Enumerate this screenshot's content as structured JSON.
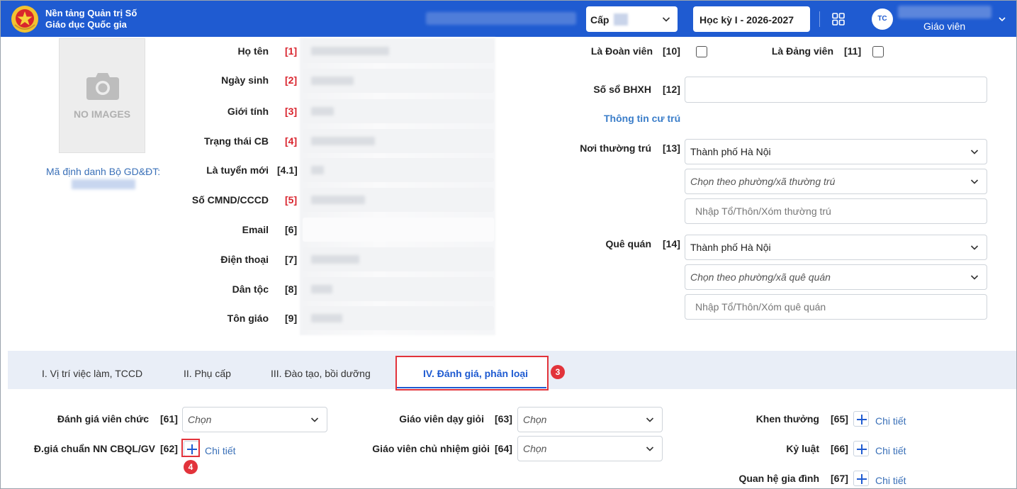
{
  "header": {
    "brand_line1": "Nền tảng Quản trị Số",
    "brand_line2": "Giáo dục Quốc gia",
    "cap_label": "Cấp",
    "term": "Học kỳ I - 2026-2027",
    "avatar_initials": "TC",
    "role": "Giáo viên"
  },
  "photo": {
    "no_images": "NO IMAGES",
    "ma_dinh_danh_label": "Mã định danh Bộ GD&ĐT:"
  },
  "left_fields": [
    {
      "label": "Họ tên",
      "num": "[1]"
    },
    {
      "label": "Ngày sinh",
      "num": "[2]"
    },
    {
      "label": "Giới tính",
      "num": "[3]"
    },
    {
      "label": "Trạng thái CB",
      "num": "[4]"
    },
    {
      "label": "Là tuyển mới",
      "num": "[4.1]"
    },
    {
      "label": "Số CMND/CCCD",
      "num": "[5]"
    },
    {
      "label": "Email",
      "num": "[6]"
    },
    {
      "label": "Điện thoại",
      "num": "[7]"
    },
    {
      "label": "Dân tộc",
      "num": "[8]"
    },
    {
      "label": "Tôn giáo",
      "num": "[9]"
    }
  ],
  "right_fields": {
    "doan_vien": {
      "label": "Là Đoàn viên",
      "num": "[10]"
    },
    "dang_vien": {
      "label": "Là Đảng viên",
      "num": "[11]"
    },
    "bhxh": {
      "label": "Số sổ BHXH",
      "num": "[12]"
    },
    "cu_tru_title": "Thông tin cư trú",
    "thuong_tru": {
      "label": "Nơi thường trú",
      "num": "[13]",
      "province": "Thành phố Hà Nội",
      "ward_placeholder": "Chọn theo phường/xã thường trú",
      "hamlet_placeholder": "Nhập Tổ/Thôn/Xóm thường trú"
    },
    "que_quan": {
      "label": "Quê quán",
      "num": "[14]",
      "province": "Thành phố Hà Nội",
      "ward_placeholder": "Chọn theo phường/xã quê quán",
      "hamlet_placeholder": "Nhập Tổ/Thôn/Xóm quê quán"
    }
  },
  "tabs": [
    {
      "label": "I. Vị trí việc làm, TCCD"
    },
    {
      "label": "II. Phụ cấp"
    },
    {
      "label": "III. Đào tạo, bồi dưỡng"
    },
    {
      "label": "IV. Đánh giá, phân loại"
    }
  ],
  "annotations": {
    "tab_step": "3",
    "plus_step": "4"
  },
  "evaluation": {
    "danh_gia_vc": {
      "label": "Đánh giá viên chức",
      "num": "[61]",
      "value": "Chọn"
    },
    "chuan_nn": {
      "label": "Đ.giá chuẩn NN CBQL/GV",
      "num": "[62]",
      "detail": "Chi tiết"
    },
    "gv_gioi": {
      "label": "Giáo viên dạy giỏi",
      "num": "[63]",
      "value": "Chọn"
    },
    "gvcn_gioi": {
      "label": "Giáo viên chủ nhiệm giỏi",
      "num": "[64]",
      "value": "Chọn"
    },
    "khen_thuong": {
      "label": "Khen thưởng",
      "num": "[65]",
      "detail": "Chi tiết"
    },
    "ky_luat": {
      "label": "Kỷ luật",
      "num": "[66]",
      "detail": "Chi tiết"
    },
    "quan_he": {
      "label": "Quan hệ gia đình",
      "num": "[67]",
      "detail": "Chi tiết"
    }
  }
}
